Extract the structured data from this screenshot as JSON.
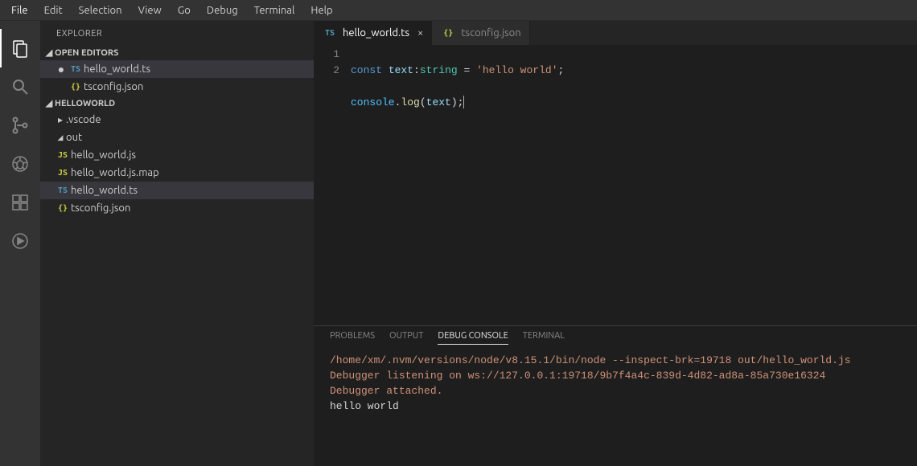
{
  "menubar": [
    "File",
    "Edit",
    "Selection",
    "View",
    "Go",
    "Debug",
    "Terminal",
    "Help"
  ],
  "activity": {
    "items": [
      {
        "name": "explorer-icon",
        "active": true
      },
      {
        "name": "search-icon"
      },
      {
        "name": "scm-icon"
      },
      {
        "name": "debug-icon"
      },
      {
        "name": "extensions-icon"
      },
      {
        "name": "live-share-icon"
      }
    ]
  },
  "sidebar": {
    "title": "EXPLORER",
    "open_editors": {
      "header": "OPEN EDITORS",
      "items": [
        {
          "dirty": true,
          "icon": "TS",
          "icon_class": "ico-ts",
          "label": "hello_world.ts"
        },
        {
          "dirty": false,
          "icon": "{}",
          "icon_class": "ico-json",
          "label": "tsconfig.json"
        }
      ]
    },
    "folder": {
      "header": "HELLOWORLD",
      "items": [
        {
          "type": "folder",
          "expanded": false,
          "label": ".vscode"
        },
        {
          "type": "folder",
          "expanded": true,
          "label": "out"
        },
        {
          "type": "file",
          "indent": true,
          "icon": "JS",
          "icon_class": "ico-js",
          "label": "hello_world.js"
        },
        {
          "type": "file",
          "indent": true,
          "icon": "JS",
          "icon_class": "ico-js",
          "label": "hello_world.js.map"
        },
        {
          "type": "file",
          "icon": "TS",
          "icon_class": "ico-ts",
          "label": "hello_world.ts",
          "selected": true
        },
        {
          "type": "file",
          "icon": "{}",
          "icon_class": "ico-json",
          "label": "tsconfig.json"
        }
      ]
    }
  },
  "tabs": [
    {
      "icon": "TS",
      "icon_class": "ico-ts",
      "label": "hello_world.ts",
      "active": true,
      "close": "×"
    },
    {
      "icon": "{}",
      "icon_class": "ico-json",
      "label": "tsconfig.json",
      "active": false
    }
  ],
  "editor": {
    "line_numbers": [
      "1",
      "2"
    ],
    "code": {
      "l1": {
        "kw": "const",
        "var1": "text",
        "colon": ":",
        "type": "string",
        "eq": " = ",
        "str": "'hello world'",
        "semi": ";"
      },
      "l2": {
        "obj": "console",
        "dot": ".",
        "fn": "log",
        "open": "(",
        "var1": "text",
        "close": ")",
        "semi": ";"
      }
    }
  },
  "panel": {
    "tabs": [
      "PROBLEMS",
      "OUTPUT",
      "DEBUG CONSOLE",
      "TERMINAL"
    ],
    "active_tab_index": 2,
    "lines": [
      {
        "class": "dbg-orange",
        "text": "/home/xm/.nvm/versions/node/v8.15.1/bin/node --inspect-brk=19718 out/hello_world.js"
      },
      {
        "class": "dbg-orange",
        "text": "Debugger listening on ws://127.0.0.1:19718/9b7f4a4c-839d-4d82-ad8a-85a730e16324"
      },
      {
        "class": "dbg-orange",
        "text": "Debugger attached."
      },
      {
        "class": "",
        "text": "hello world"
      }
    ]
  }
}
